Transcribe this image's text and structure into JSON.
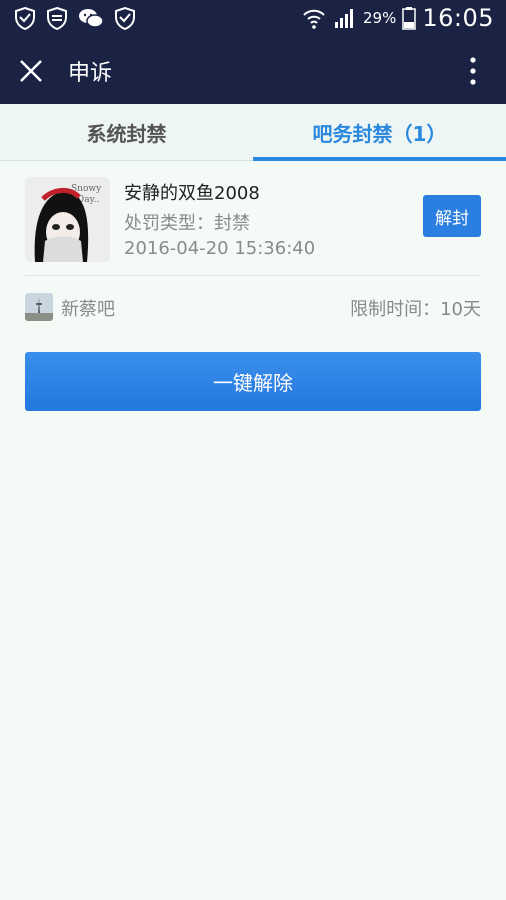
{
  "status_bar": {
    "battery_percent": "29%",
    "time": "16:05",
    "icons": [
      "shield-icon",
      "shield-icon",
      "wechat-icon",
      "shield-icon",
      "wifi-icon",
      "signal-icon",
      "battery-icon"
    ]
  },
  "header": {
    "title": "申诉",
    "close_icon": "close-icon",
    "more_icon": "more-vertical-icon"
  },
  "tabs": [
    {
      "label": "系统封禁",
      "active": false
    },
    {
      "label": "吧务封禁（1）",
      "active": true
    }
  ],
  "ban_item": {
    "username": "安静的双鱼2008",
    "penalty_type": "处罚类型：封禁",
    "datetime": "2016-04-20 15:36:40",
    "unban_label": "解封",
    "bar_name": "新蔡吧",
    "limit_time": "限制时间：10天"
  },
  "one_key_label": "一键解除",
  "colors": {
    "header_bg": "#1a2344",
    "accent": "#2a88de",
    "button": "#2a7fe0",
    "page_bg": "#f4fbf6"
  }
}
